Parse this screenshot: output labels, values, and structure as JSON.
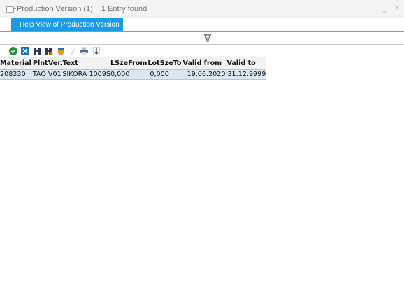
{
  "window": {
    "title": "Production Version (1)",
    "entry_count": "1 Entry found",
    "icon": "dialog-icon",
    "controls": "_ X"
  },
  "tab": {
    "label": "Help View of Production Version"
  },
  "filter": {
    "icon": "filter-funnel-icon"
  },
  "toolbar": {
    "icons": [
      "check-icon",
      "cancel-icon",
      "find-icon",
      "find-next-icon",
      "add-to-list-icon",
      "bookmark-icon",
      "print-icon",
      "sort-icon"
    ]
  },
  "table": {
    "columns": [
      "Material",
      "Plnt",
      "Ver.",
      "Text",
      "LSzeFrom",
      "LotSzeTo",
      "Valid from",
      "Valid to"
    ],
    "rows": [
      [
        "208330",
        "TAO",
        "V01",
        "SIKORA 1009S",
        "0,000",
        "0,000",
        "19.06.2020",
        "31.12.9999"
      ]
    ]
  },
  "colors": {
    "tab_bg": "#1a9be6",
    "accent_line": "#f07c2a",
    "row_selected": "#dbe8f1"
  }
}
